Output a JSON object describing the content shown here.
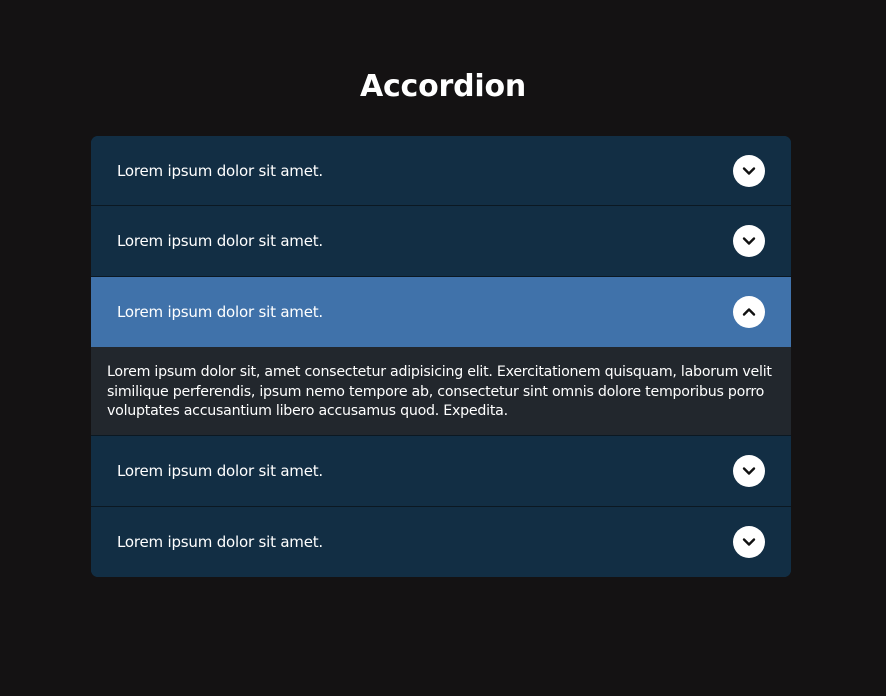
{
  "page": {
    "title": "Accordion"
  },
  "accordion": {
    "items": [
      {
        "label": "Lorem ipsum dolor sit amet.",
        "expanded": false,
        "icon": "chevron-down-icon"
      },
      {
        "label": "Lorem ipsum dolor sit amet.",
        "expanded": false,
        "icon": "chevron-down-icon"
      },
      {
        "label": "Lorem ipsum dolor sit amet.",
        "expanded": true,
        "icon": "chevron-up-icon",
        "content": "Lorem ipsum dolor sit, amet consectetur adipisicing elit. Exercitationem quisquam, laborum velit similique perferendis, ipsum nemo tempore ab, consectetur sint omnis dolore temporibus porro voluptates accusantium libero accusamus quod. Expedita."
      },
      {
        "label": "Lorem ipsum dolor sit amet.",
        "expanded": false,
        "icon": "chevron-down-icon"
      },
      {
        "label": "Lorem ipsum dolor sit amet.",
        "expanded": false,
        "icon": "chevron-down-icon"
      }
    ]
  },
  "colors": {
    "background": "#141213",
    "header": "#122e44",
    "header_active": "#4072aa",
    "panel": "#22272d",
    "text": "#ffffff"
  }
}
